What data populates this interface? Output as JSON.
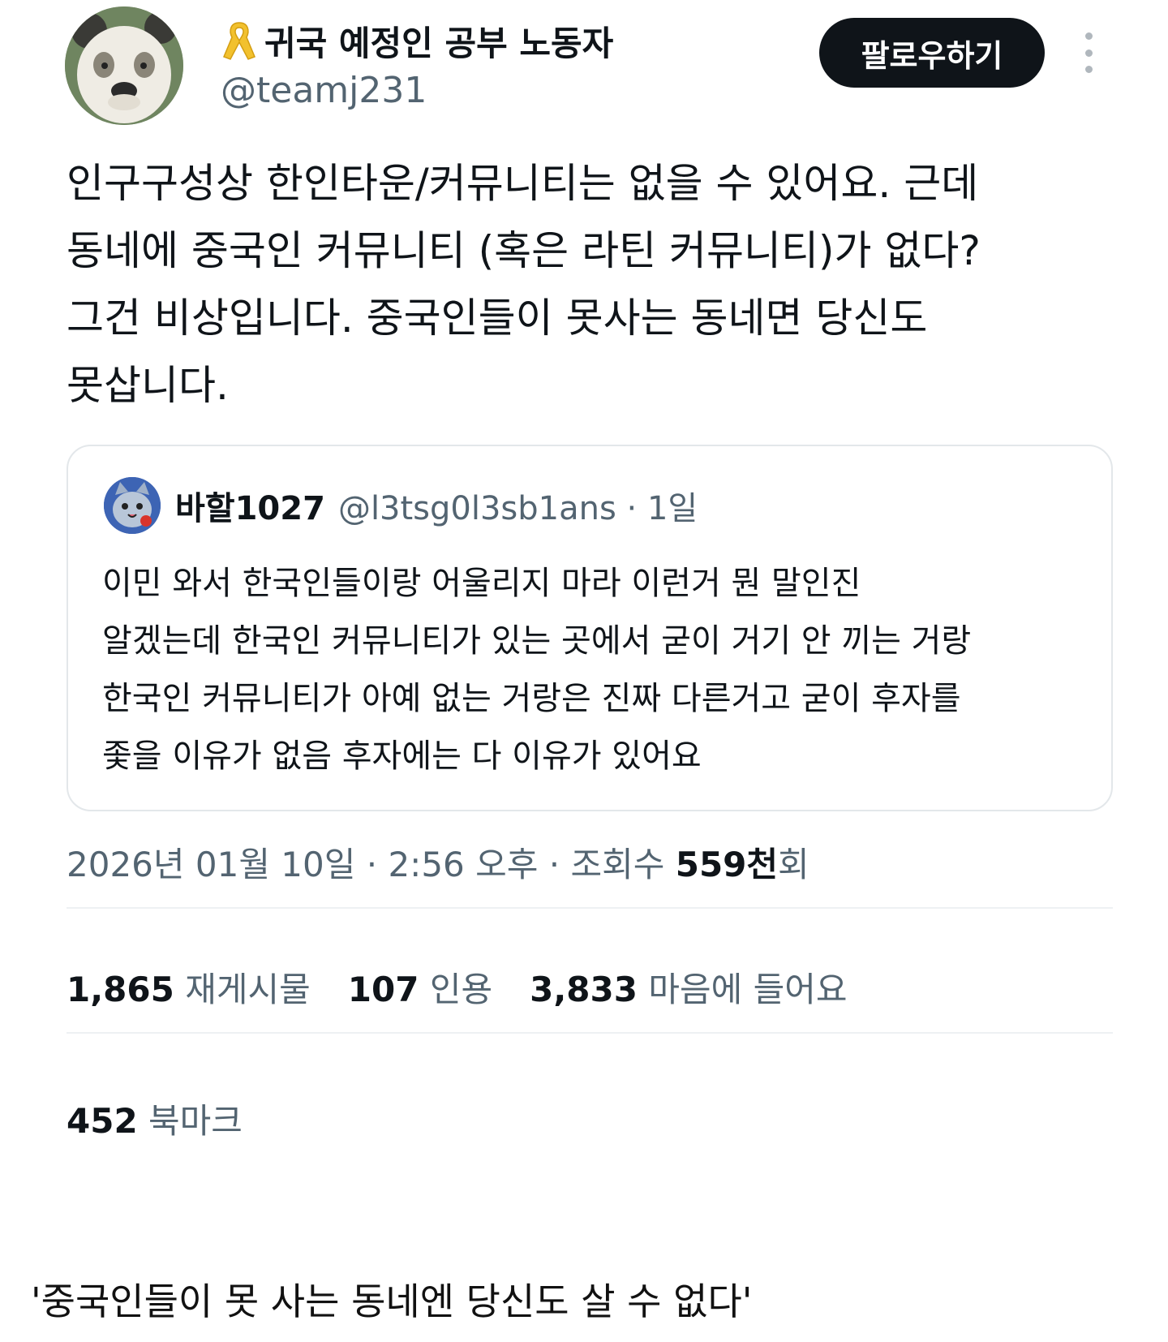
{
  "author": {
    "display_name": "귀국 예정인 공부 노동자",
    "handle": "@teamj231"
  },
  "follow_label": "팔로우하기",
  "tweet_text": "인구구성상 한인타운/커뮤니티는 없을 수 있어요. 근데\n동네에 중국인 커뮤니티 (혹은 라틴 커뮤니티)가 없다?\n그건 비상입니다. 중국인들이 못사는 동네면 당신도\n못삽니다.",
  "quote": {
    "name": "바할1027",
    "handle_time": "@l3tsg0l3sb1ans · 1일",
    "text": "이민 와서 한국인들이랑 어울리지 마라 이런거 뭔 말인진\n알겠는데 한국인 커뮤니티가 있는 곳에서 굳이 거기 안 끼는 거랑\n한국인 커뮤니티가 아예 없는 거랑은 진짜 다른거고 굳이 후자를\n좇을 이유가 없음 후자에는 다 이유가 있어요"
  },
  "meta": {
    "timestamp": "2026년 01월 10일 · 2:56 오후 · 조회수 ",
    "views": "559천",
    "views_suffix": "회"
  },
  "stats": {
    "retweets": {
      "count": "1,865",
      "label": "재게시물"
    },
    "quotes": {
      "count": "107",
      "label": "인용"
    },
    "likes": {
      "count": "3,833",
      "label": "마음에 들어요"
    },
    "bookmarks": {
      "count": "452",
      "label": "북마크"
    }
  },
  "caption": "'중국인들이 못 사는 동네엔 당신도 살 수 없다'",
  "icons": {
    "ribbon": "yellow-ribbon-icon",
    "more": "more-vertical-icon"
  },
  "colors": {
    "text": "#0f1419",
    "secondary": "#536471",
    "button_bg": "#0f1419",
    "border": "#e3e7ea",
    "ribbon": "#f2c12e"
  }
}
